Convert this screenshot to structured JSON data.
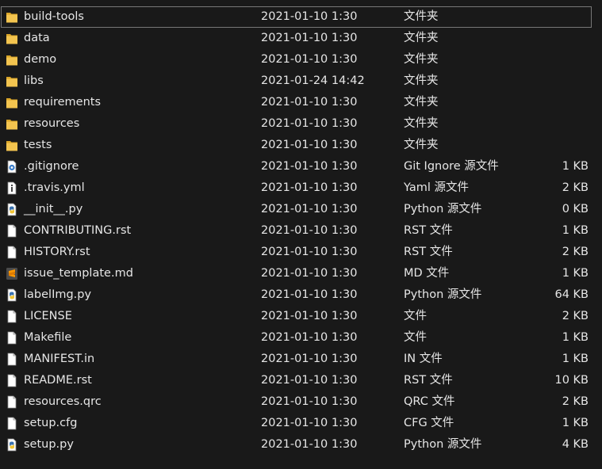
{
  "files": [
    {
      "name": "build-tools",
      "date": "2021-01-10 1:30",
      "type": "文件夹",
      "size": "",
      "icon": "folder-icon"
    },
    {
      "name": "data",
      "date": "2021-01-10 1:30",
      "type": "文件夹",
      "size": "",
      "icon": "folder-icon"
    },
    {
      "name": "demo",
      "date": "2021-01-10 1:30",
      "type": "文件夹",
      "size": "",
      "icon": "folder-icon"
    },
    {
      "name": "libs",
      "date": "2021-01-24 14:42",
      "type": "文件夹",
      "size": "",
      "icon": "folder-icon"
    },
    {
      "name": "requirements",
      "date": "2021-01-10 1:30",
      "type": "文件夹",
      "size": "",
      "icon": "folder-icon"
    },
    {
      "name": "resources",
      "date": "2021-01-10 1:30",
      "type": "文件夹",
      "size": "",
      "icon": "folder-icon"
    },
    {
      "name": "tests",
      "date": "2021-01-10 1:30",
      "type": "文件夹",
      "size": "",
      "icon": "folder-icon"
    },
    {
      "name": ".gitignore",
      "date": "2021-01-10 1:30",
      "type": "Git Ignore 源文件",
      "size": "1 KB",
      "icon": "gear-file-icon"
    },
    {
      "name": ".travis.yml",
      "date": "2021-01-10 1:30",
      "type": "Yaml 源文件",
      "size": "2 KB",
      "icon": "info-file-icon"
    },
    {
      "name": "__init__.py",
      "date": "2021-01-10 1:30",
      "type": "Python 源文件",
      "size": "0 KB",
      "icon": "python-file-icon"
    },
    {
      "name": "CONTRIBUTING.rst",
      "date": "2021-01-10 1:30",
      "type": "RST 文件",
      "size": "1 KB",
      "icon": "blank-file-icon"
    },
    {
      "name": "HISTORY.rst",
      "date": "2021-01-10 1:30",
      "type": "RST 文件",
      "size": "2 KB",
      "icon": "blank-file-icon"
    },
    {
      "name": "issue_template.md",
      "date": "2021-01-10 1:30",
      "type": "MD 文件",
      "size": "1 KB",
      "icon": "sublime-file-icon"
    },
    {
      "name": "labelImg.py",
      "date": "2021-01-10 1:30",
      "type": "Python 源文件",
      "size": "64 KB",
      "icon": "python-file-icon"
    },
    {
      "name": "LICENSE",
      "date": "2021-01-10 1:30",
      "type": "文件",
      "size": "2 KB",
      "icon": "blank-file-icon"
    },
    {
      "name": "Makefile",
      "date": "2021-01-10 1:30",
      "type": "文件",
      "size": "1 KB",
      "icon": "blank-file-icon"
    },
    {
      "name": "MANIFEST.in",
      "date": "2021-01-10 1:30",
      "type": "IN 文件",
      "size": "1 KB",
      "icon": "blank-file-icon"
    },
    {
      "name": "README.rst",
      "date": "2021-01-10 1:30",
      "type": "RST 文件",
      "size": "10 KB",
      "icon": "blank-file-icon"
    },
    {
      "name": "resources.qrc",
      "date": "2021-01-10 1:30",
      "type": "QRC 文件",
      "size": "2 KB",
      "icon": "blank-file-icon"
    },
    {
      "name": "setup.cfg",
      "date": "2021-01-10 1:30",
      "type": "CFG 文件",
      "size": "1 KB",
      "icon": "blank-file-icon"
    },
    {
      "name": "setup.py",
      "date": "2021-01-10 1:30",
      "type": "Python 源文件",
      "size": "4 KB",
      "icon": "python-file-icon"
    }
  ],
  "selected_index": 0,
  "colors": {
    "background": "#191919",
    "text": "#e6e6e6",
    "folder": "#f3c44f",
    "selection_border": "#777777"
  }
}
